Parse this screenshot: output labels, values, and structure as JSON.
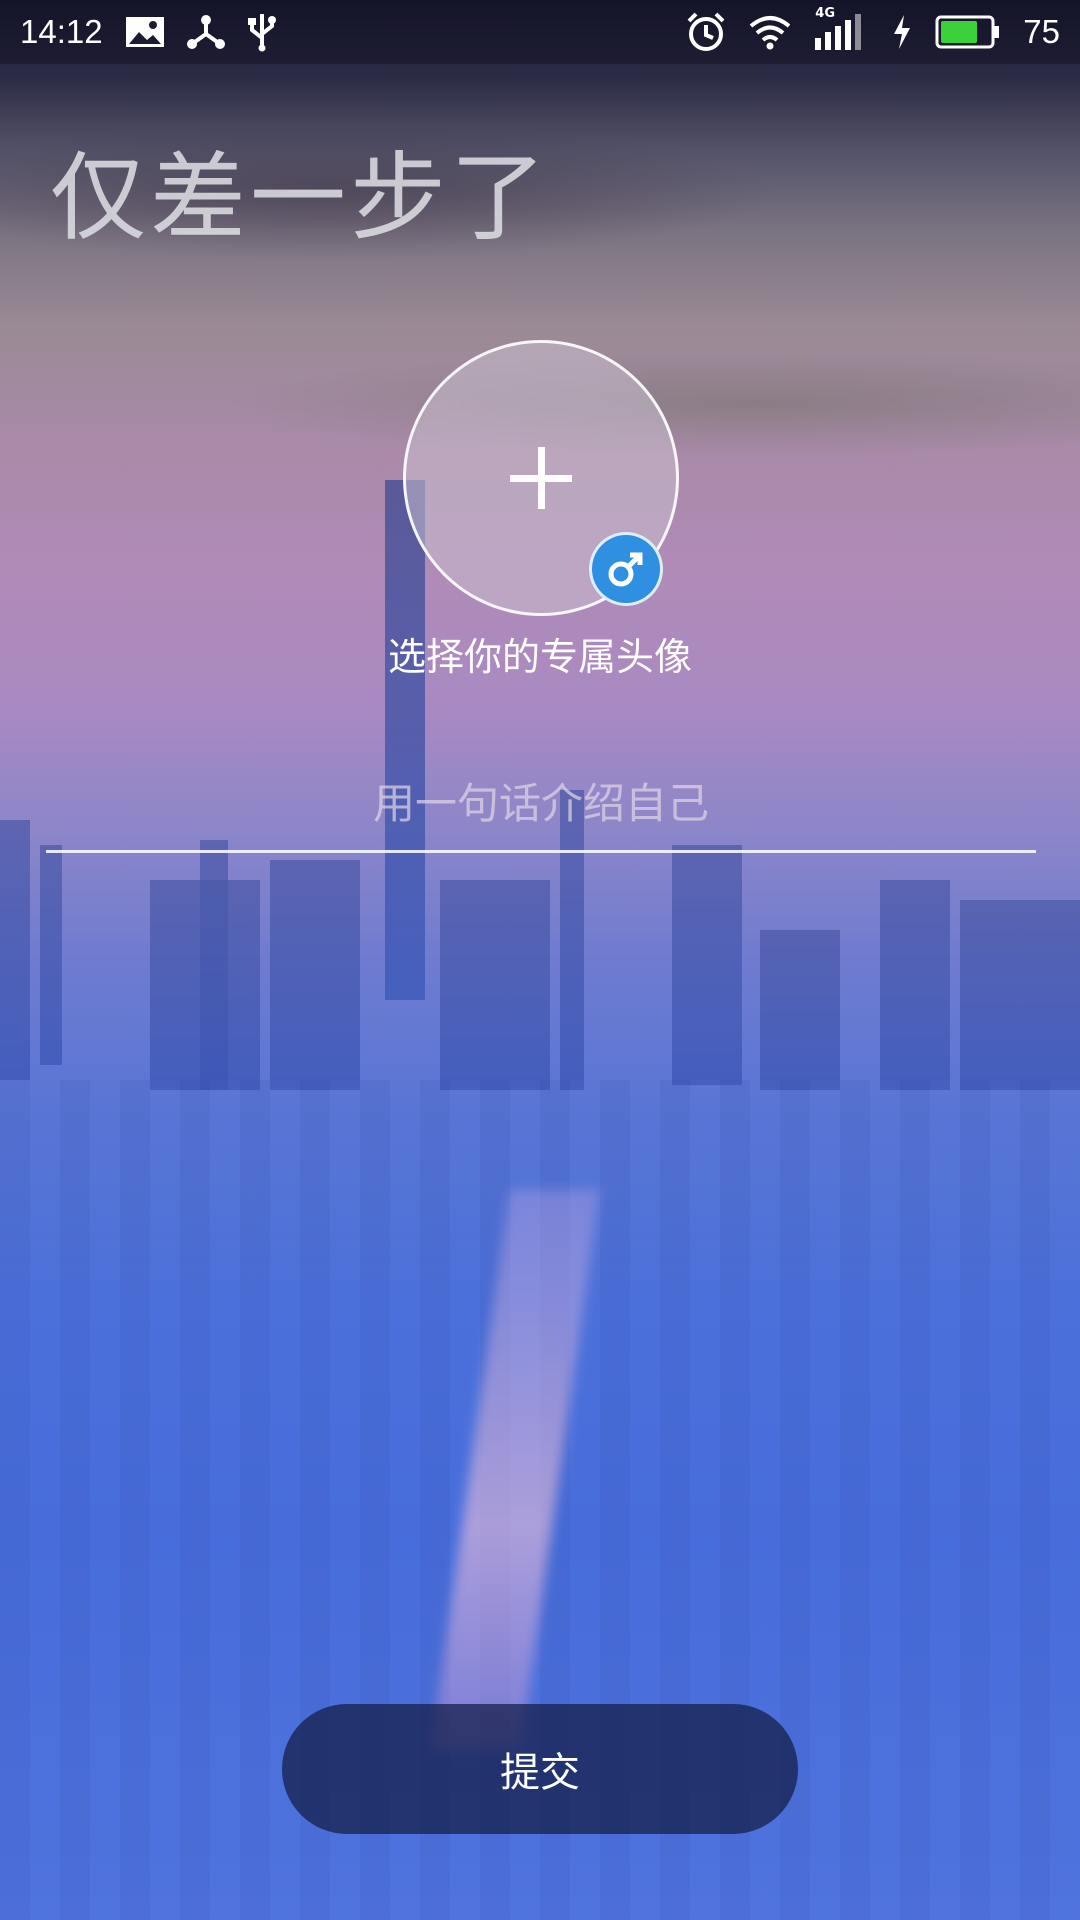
{
  "status_bar": {
    "time": "14:12",
    "network_label": "4G",
    "battery_level": "75",
    "battery_color": "#3ad13a",
    "icons": [
      "image-icon",
      "share-icon",
      "usb-icon",
      "alarm-icon",
      "wifi-icon",
      "signal-icon",
      "charging-icon",
      "battery-icon"
    ]
  },
  "page": {
    "headline": "仅差一步了",
    "avatar_caption": "选择你的专属头像",
    "gender": "male",
    "gender_badge_color": "#2f8fe0",
    "bio_placeholder": "用一句话介绍自己",
    "bio_value": "",
    "submit_label": "提交"
  }
}
